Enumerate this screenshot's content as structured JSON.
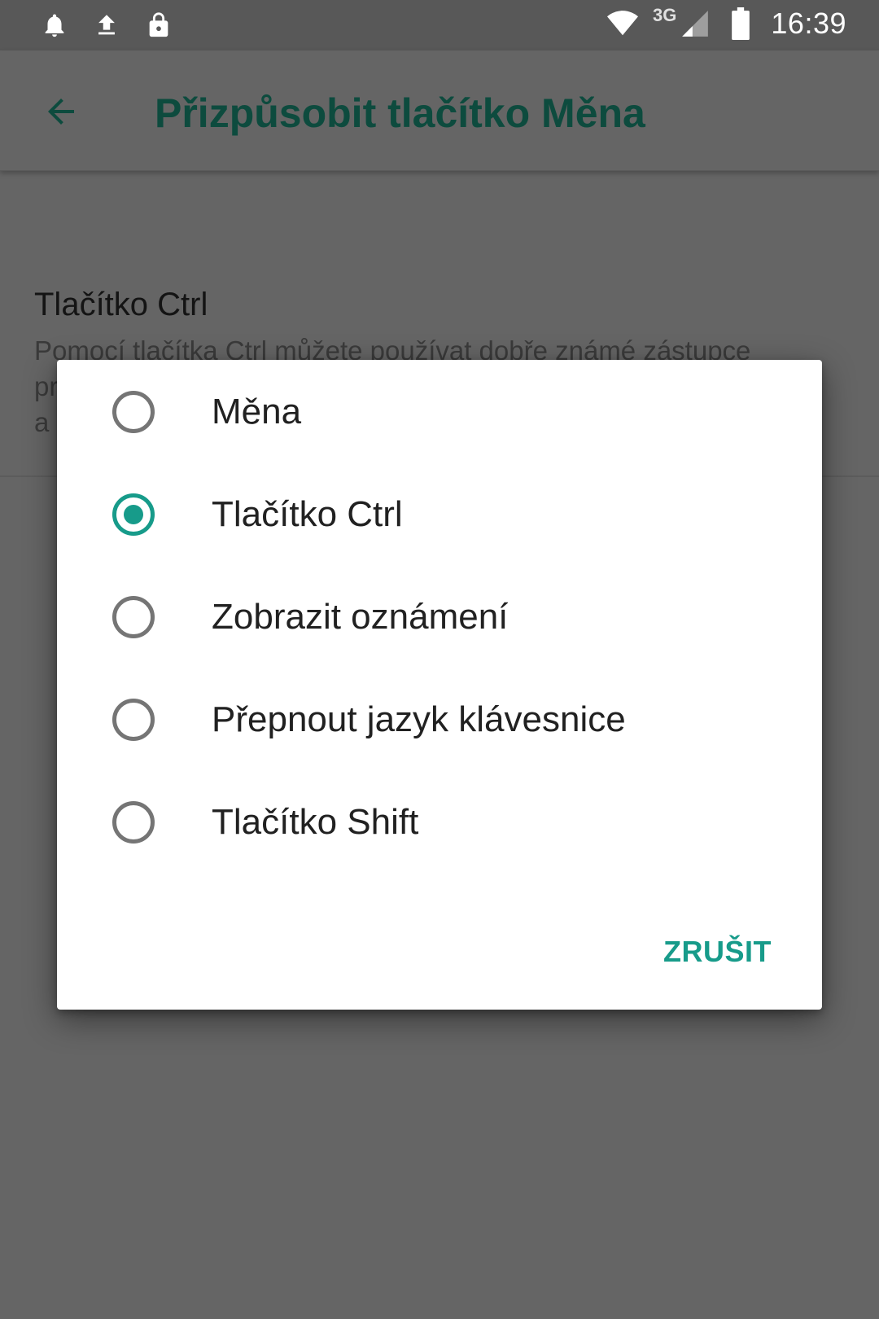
{
  "status_bar": {
    "left_icons": [
      "bell-icon",
      "upload-icon",
      "lock-icon"
    ],
    "network_label": "3G",
    "time": "16:39"
  },
  "app_bar": {
    "title": "Přizpůsobit tlačítko Měna",
    "back_icon": "arrow-left-icon"
  },
  "background": {
    "pref_title": "Tlačítko Ctrl",
    "pref_summary_line1": "Pomocí tlačítka Ctrl můžete používat dobře známé zástupce",
    "pref_summary_line2": "pr",
    "pref_summary_line3": "a"
  },
  "dialog": {
    "options": [
      {
        "label": "Měna",
        "checked": false
      },
      {
        "label": "Tlačítko Ctrl",
        "checked": true
      },
      {
        "label": "Zobrazit oznámení",
        "checked": false
      },
      {
        "label": "Přepnout jazyk klávesnice",
        "checked": false
      },
      {
        "label": "Tlačítko Shift",
        "checked": false
      }
    ],
    "cancel_label": "ZRUŠIT"
  },
  "colors": {
    "accent": "#179b8a",
    "title": "#0d4b3e",
    "scrim_background": "#656565",
    "status_bar": "#585858"
  }
}
